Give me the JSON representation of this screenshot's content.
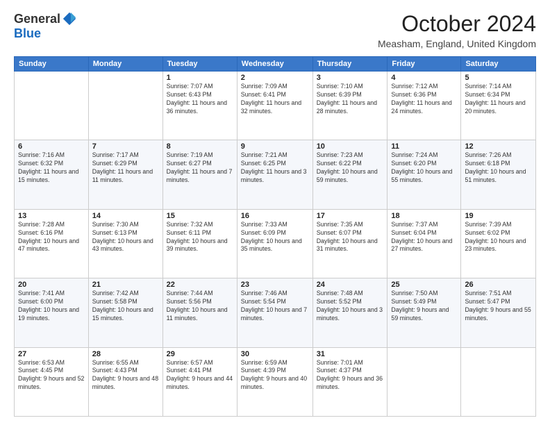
{
  "logo": {
    "general": "General",
    "blue": "Blue"
  },
  "header": {
    "month": "October 2024",
    "location": "Measham, England, United Kingdom"
  },
  "weekdays": [
    "Sunday",
    "Monday",
    "Tuesday",
    "Wednesday",
    "Thursday",
    "Friday",
    "Saturday"
  ],
  "weeks": [
    [
      {
        "day": "",
        "detail": ""
      },
      {
        "day": "",
        "detail": ""
      },
      {
        "day": "1",
        "detail": "Sunrise: 7:07 AM\nSunset: 6:43 PM\nDaylight: 11 hours and 36 minutes."
      },
      {
        "day": "2",
        "detail": "Sunrise: 7:09 AM\nSunset: 6:41 PM\nDaylight: 11 hours and 32 minutes."
      },
      {
        "day": "3",
        "detail": "Sunrise: 7:10 AM\nSunset: 6:39 PM\nDaylight: 11 hours and 28 minutes."
      },
      {
        "day": "4",
        "detail": "Sunrise: 7:12 AM\nSunset: 6:36 PM\nDaylight: 11 hours and 24 minutes."
      },
      {
        "day": "5",
        "detail": "Sunrise: 7:14 AM\nSunset: 6:34 PM\nDaylight: 11 hours and 20 minutes."
      }
    ],
    [
      {
        "day": "6",
        "detail": "Sunrise: 7:16 AM\nSunset: 6:32 PM\nDaylight: 11 hours and 15 minutes."
      },
      {
        "day": "7",
        "detail": "Sunrise: 7:17 AM\nSunset: 6:29 PM\nDaylight: 11 hours and 11 minutes."
      },
      {
        "day": "8",
        "detail": "Sunrise: 7:19 AM\nSunset: 6:27 PM\nDaylight: 11 hours and 7 minutes."
      },
      {
        "day": "9",
        "detail": "Sunrise: 7:21 AM\nSunset: 6:25 PM\nDaylight: 11 hours and 3 minutes."
      },
      {
        "day": "10",
        "detail": "Sunrise: 7:23 AM\nSunset: 6:22 PM\nDaylight: 10 hours and 59 minutes."
      },
      {
        "day": "11",
        "detail": "Sunrise: 7:24 AM\nSunset: 6:20 PM\nDaylight: 10 hours and 55 minutes."
      },
      {
        "day": "12",
        "detail": "Sunrise: 7:26 AM\nSunset: 6:18 PM\nDaylight: 10 hours and 51 minutes."
      }
    ],
    [
      {
        "day": "13",
        "detail": "Sunrise: 7:28 AM\nSunset: 6:16 PM\nDaylight: 10 hours and 47 minutes."
      },
      {
        "day": "14",
        "detail": "Sunrise: 7:30 AM\nSunset: 6:13 PM\nDaylight: 10 hours and 43 minutes."
      },
      {
        "day": "15",
        "detail": "Sunrise: 7:32 AM\nSunset: 6:11 PM\nDaylight: 10 hours and 39 minutes."
      },
      {
        "day": "16",
        "detail": "Sunrise: 7:33 AM\nSunset: 6:09 PM\nDaylight: 10 hours and 35 minutes."
      },
      {
        "day": "17",
        "detail": "Sunrise: 7:35 AM\nSunset: 6:07 PM\nDaylight: 10 hours and 31 minutes."
      },
      {
        "day": "18",
        "detail": "Sunrise: 7:37 AM\nSunset: 6:04 PM\nDaylight: 10 hours and 27 minutes."
      },
      {
        "day": "19",
        "detail": "Sunrise: 7:39 AM\nSunset: 6:02 PM\nDaylight: 10 hours and 23 minutes."
      }
    ],
    [
      {
        "day": "20",
        "detail": "Sunrise: 7:41 AM\nSunset: 6:00 PM\nDaylight: 10 hours and 19 minutes."
      },
      {
        "day": "21",
        "detail": "Sunrise: 7:42 AM\nSunset: 5:58 PM\nDaylight: 10 hours and 15 minutes."
      },
      {
        "day": "22",
        "detail": "Sunrise: 7:44 AM\nSunset: 5:56 PM\nDaylight: 10 hours and 11 minutes."
      },
      {
        "day": "23",
        "detail": "Sunrise: 7:46 AM\nSunset: 5:54 PM\nDaylight: 10 hours and 7 minutes."
      },
      {
        "day": "24",
        "detail": "Sunrise: 7:48 AM\nSunset: 5:52 PM\nDaylight: 10 hours and 3 minutes."
      },
      {
        "day": "25",
        "detail": "Sunrise: 7:50 AM\nSunset: 5:49 PM\nDaylight: 9 hours and 59 minutes."
      },
      {
        "day": "26",
        "detail": "Sunrise: 7:51 AM\nSunset: 5:47 PM\nDaylight: 9 hours and 55 minutes."
      }
    ],
    [
      {
        "day": "27",
        "detail": "Sunrise: 6:53 AM\nSunset: 4:45 PM\nDaylight: 9 hours and 52 minutes."
      },
      {
        "day": "28",
        "detail": "Sunrise: 6:55 AM\nSunset: 4:43 PM\nDaylight: 9 hours and 48 minutes."
      },
      {
        "day": "29",
        "detail": "Sunrise: 6:57 AM\nSunset: 4:41 PM\nDaylight: 9 hours and 44 minutes."
      },
      {
        "day": "30",
        "detail": "Sunrise: 6:59 AM\nSunset: 4:39 PM\nDaylight: 9 hours and 40 minutes."
      },
      {
        "day": "31",
        "detail": "Sunrise: 7:01 AM\nSunset: 4:37 PM\nDaylight: 9 hours and 36 minutes."
      },
      {
        "day": "",
        "detail": ""
      },
      {
        "day": "",
        "detail": ""
      }
    ]
  ]
}
